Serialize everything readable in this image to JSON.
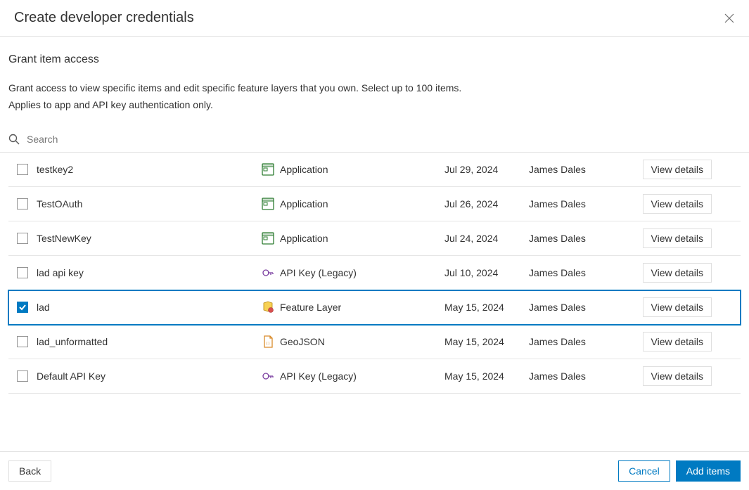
{
  "header": {
    "title": "Create developer credentials"
  },
  "section": {
    "title": "Grant item access",
    "desc1": "Grant access to view specific items and edit specific feature layers that you own. Select up to 100 items.",
    "desc2": "Applies to app and API key authentication only."
  },
  "search": {
    "placeholder": "Search"
  },
  "table": {
    "rows": [
      {
        "name": "testkey2",
        "type": "Application",
        "icon": "application",
        "date": "Jul 29, 2024",
        "owner": "James Dales",
        "selected": false
      },
      {
        "name": "TestOAuth",
        "type": "Application",
        "icon": "application",
        "date": "Jul 26, 2024",
        "owner": "James Dales",
        "selected": false
      },
      {
        "name": "TestNewKey",
        "type": "Application",
        "icon": "application",
        "date": "Jul 24, 2024",
        "owner": "James Dales",
        "selected": false
      },
      {
        "name": "lad api key",
        "type": "API Key (Legacy)",
        "icon": "apikey",
        "date": "Jul 10, 2024",
        "owner": "James Dales",
        "selected": false
      },
      {
        "name": "lad",
        "type": "Feature Layer",
        "icon": "feature",
        "date": "May 15, 2024",
        "owner": "James Dales",
        "selected": true
      },
      {
        "name": "lad_unformatted",
        "type": "GeoJSON",
        "icon": "geojson",
        "date": "May 15, 2024",
        "owner": "James Dales",
        "selected": false
      },
      {
        "name": "Default API Key",
        "type": "API Key (Legacy)",
        "icon": "apikey",
        "date": "May 15, 2024",
        "owner": "James Dales",
        "selected": false
      }
    ],
    "viewDetailsLabel": "View details"
  },
  "footer": {
    "back": "Back",
    "cancel": "Cancel",
    "addItems": "Add items"
  }
}
